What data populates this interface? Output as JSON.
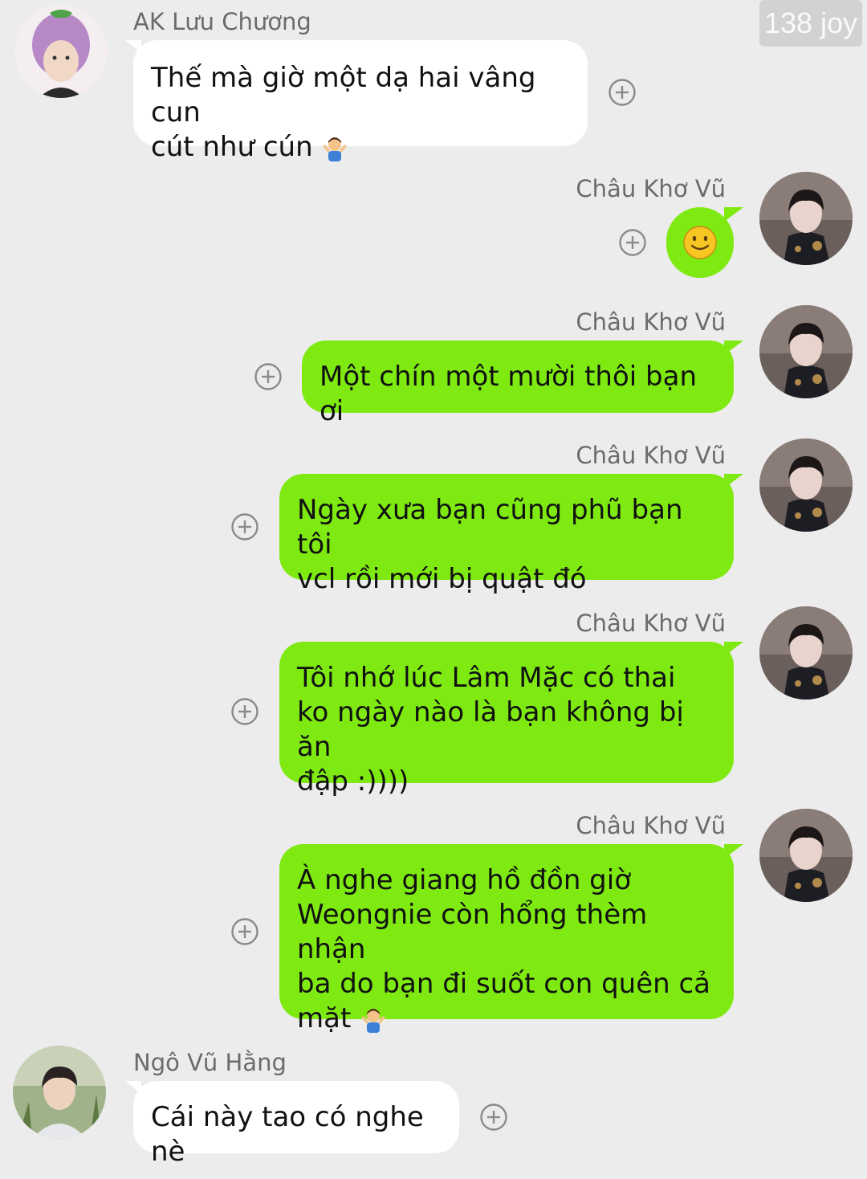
{
  "watermark": "138 joy",
  "colors": {
    "outgoing_bubble": "#7fea11",
    "incoming_bubble": "#ffffff",
    "background": "#ececec",
    "sender_name": "#6b6b6b"
  },
  "messages": [
    {
      "sender": "AK Lưu Chương",
      "direction": "incoming",
      "lines": [
        "Thế mà giờ một dạ hai vâng cun",
        "cút như cún"
      ],
      "trailing_emoji": "person-shrugging-icon"
    },
    {
      "sender": "Châu Khơ Vũ",
      "direction": "outgoing",
      "emoji_only": "slightly-smiling-face-icon"
    },
    {
      "sender": "Châu Khơ Vũ",
      "direction": "outgoing",
      "lines": [
        "Một chín một mười thôi bạn ơi"
      ]
    },
    {
      "sender": "Châu Khơ Vũ",
      "direction": "outgoing",
      "lines": [
        "Ngày xưa bạn cũng phũ bạn tôi",
        "vcl rồi mới bị quật đó"
      ]
    },
    {
      "sender": "Châu Khơ Vũ",
      "direction": "outgoing",
      "lines": [
        "Tôi nhớ lúc Lâm Mặc có thai",
        "ko ngày nào là bạn không bị ăn",
        "đập :))))"
      ]
    },
    {
      "sender": "Châu Khơ Vũ",
      "direction": "outgoing",
      "lines": [
        "À nghe giang hồ đồn giờ",
        "Weongnie còn hổng thèm nhận",
        "ba do bạn đi suốt con quên cả",
        "mặt"
      ],
      "trailing_emoji": "person-shrugging-icon"
    },
    {
      "sender": "Ngô Vũ Hằng",
      "direction": "incoming",
      "lines": [
        "Cái này tao có nghe nè"
      ]
    }
  ]
}
